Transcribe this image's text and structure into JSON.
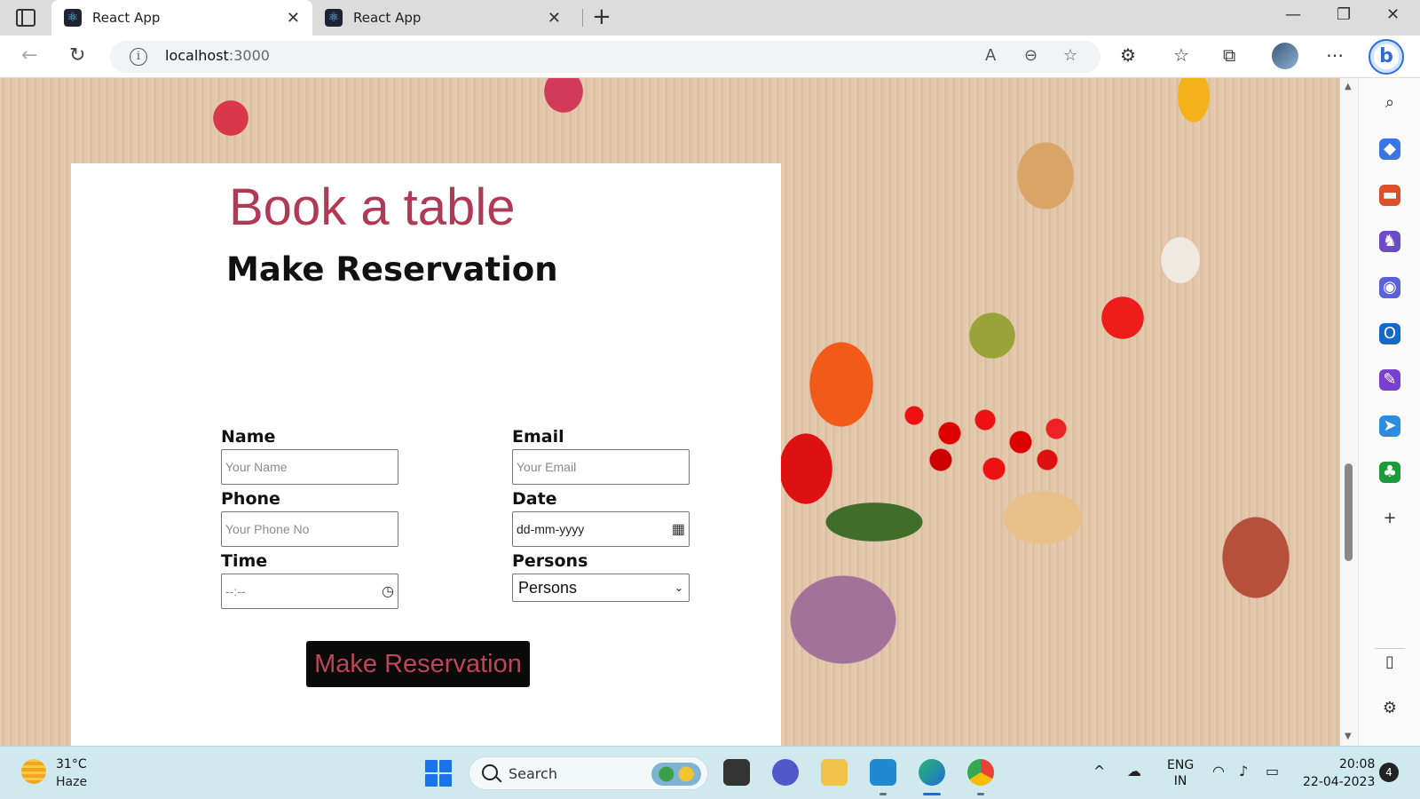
{
  "browser": {
    "tabs": [
      {
        "title": "React App",
        "active": true
      },
      {
        "title": "React App",
        "active": false
      }
    ],
    "url_host": "localhost",
    "url_port": ":3000"
  },
  "page": {
    "heading": "Book a table",
    "subheading": "Make Reservation",
    "form": {
      "name_label": "Name",
      "name_placeholder": "Your Name",
      "email_label": "Email",
      "email_placeholder": "Your Email",
      "phone_label": "Phone",
      "phone_placeholder": "Your Phone No",
      "date_label": "Date",
      "date_value": "dd-mm-yyyy",
      "time_label": "Time",
      "time_value": "--:--",
      "persons_label": "Persons",
      "persons_selected": "Persons",
      "submit_label": "Make Reservation"
    }
  },
  "colors": {
    "heading": "#b03a56",
    "button_bg": "#0a0a0a",
    "button_text": "#c0445a"
  },
  "taskbar": {
    "weather_temp": "31°C",
    "weather_condition": "Haze",
    "search_label": "Search",
    "lang_line1": "ENG",
    "lang_line2": "IN",
    "time": "20:08",
    "date": "22-04-2023",
    "notification_count": "4"
  }
}
